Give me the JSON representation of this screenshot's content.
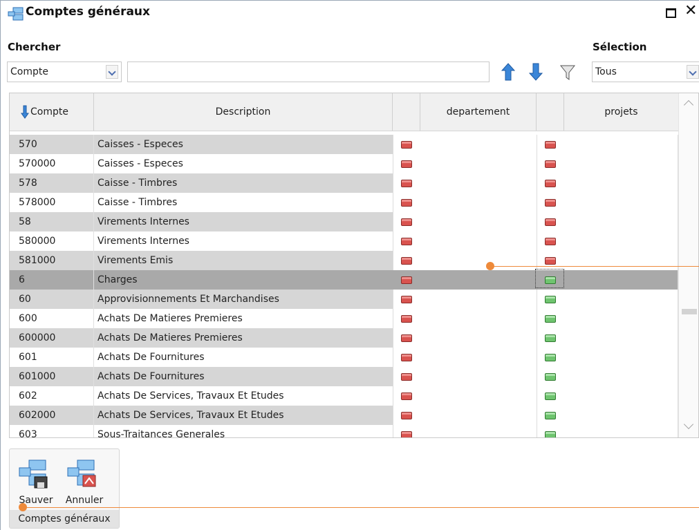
{
  "window": {
    "title": "Comptes généraux"
  },
  "search": {
    "label": "Chercher",
    "field_value": "Compte",
    "text_value": ""
  },
  "selection": {
    "label": "Sélection",
    "value": "Tous"
  },
  "grid": {
    "columns": [
      "Compte",
      "Description",
      "departement",
      "projets"
    ],
    "rows": [
      {
        "code": "570",
        "desc": "Caisses - Especes",
        "dep": "red",
        "proj": "red"
      },
      {
        "code": "570000",
        "desc": "Caisses - Especes",
        "dep": "red",
        "proj": "red"
      },
      {
        "code": "578",
        "desc": "Caisse - Timbres",
        "dep": "red",
        "proj": "red"
      },
      {
        "code": "578000",
        "desc": "Caisse - Timbres",
        "dep": "red",
        "proj": "red"
      },
      {
        "code": "58",
        "desc": "Virements Internes",
        "dep": "red",
        "proj": "red"
      },
      {
        "code": "580000",
        "desc": "Virements Internes",
        "dep": "red",
        "proj": "red"
      },
      {
        "code": "581000",
        "desc": "Virements Emis",
        "dep": "red",
        "proj": "red"
      },
      {
        "code": "6",
        "desc": "Charges",
        "dep": "red",
        "proj": "green"
      },
      {
        "code": "60",
        "desc": "Approvisionnements Et Marchandises",
        "dep": "red",
        "proj": "green"
      },
      {
        "code": "600",
        "desc": "Achats De Matieres Premieres",
        "dep": "red",
        "proj": "green"
      },
      {
        "code": "600000",
        "desc": "Achats De Matieres Premieres",
        "dep": "red",
        "proj": "green"
      },
      {
        "code": "601",
        "desc": "Achats De Fournitures",
        "dep": "red",
        "proj": "green"
      },
      {
        "code": "601000",
        "desc": "Achats De Fournitures",
        "dep": "red",
        "proj": "green"
      },
      {
        "code": "602",
        "desc": "Achats De Services, Travaux Et Etudes",
        "dep": "red",
        "proj": "green"
      },
      {
        "code": "602000",
        "desc": "Achats De Services, Travaux Et Etudes",
        "dep": "red",
        "proj": "green"
      },
      {
        "code": "603",
        "desc": "Sous-Traitances Generales",
        "dep": "red",
        "proj": "green"
      }
    ],
    "selected_code": "6"
  },
  "ribbon": {
    "save_label": "Sauver",
    "cancel_label": "Annuler",
    "group_label": "Comptes généraux"
  },
  "colors": {
    "flag_red": "#d9534f",
    "flag_green": "#6fc46f",
    "accent": "#ee8a3a",
    "row_selected": "#a9a9a9"
  }
}
